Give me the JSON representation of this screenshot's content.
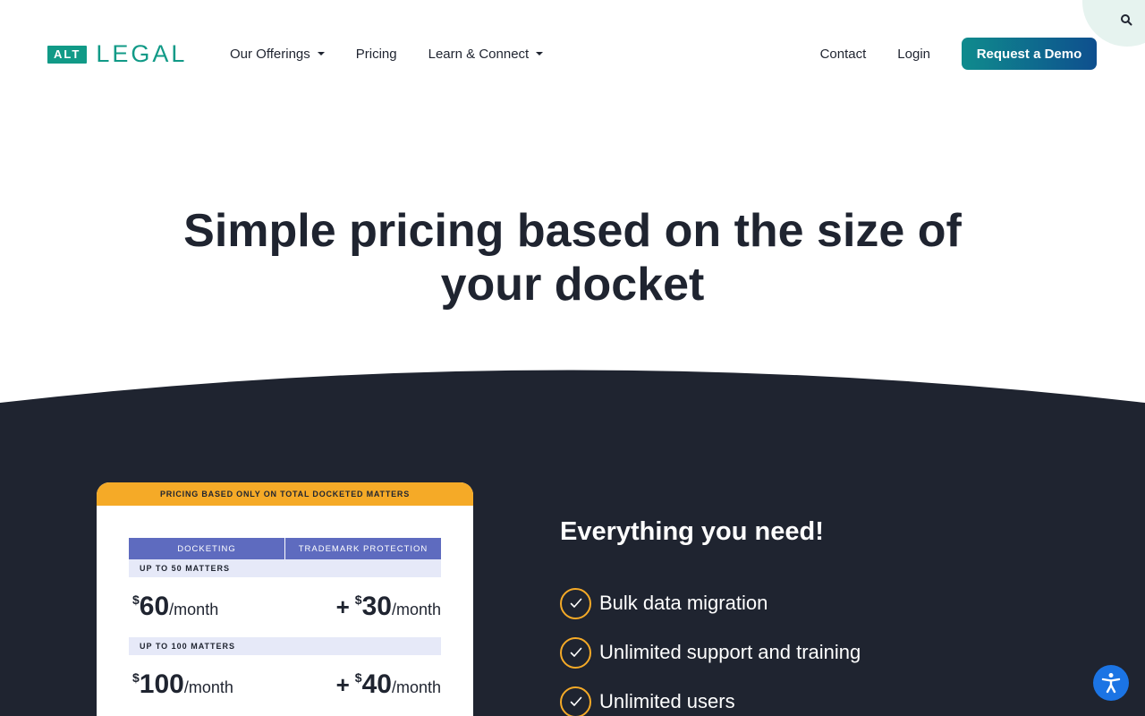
{
  "header": {
    "logo": {
      "badge": "ALT",
      "wordmark": "LEGAL"
    },
    "nav": [
      {
        "label": "Our Offerings",
        "has_dropdown": true
      },
      {
        "label": "Pricing",
        "has_dropdown": false
      },
      {
        "label": "Learn & Connect",
        "has_dropdown": true
      }
    ],
    "contact_label": "Contact",
    "login_label": "Login",
    "demo_button_label": "Request a Demo",
    "search_icon": "search-icon"
  },
  "hero": {
    "title_line1": "Simple pricing based on the size of",
    "title_line2": "your docket"
  },
  "pricing_card": {
    "banner": "PRICING BASED ONLY ON TOTAL DOCKETED MATTERS",
    "columns": [
      "DOCKETING",
      "TRADEMARK PROTECTION"
    ],
    "tiers": [
      {
        "label": "UP TO 50 MATTERS",
        "docketing": {
          "currency": "$",
          "amount": "60",
          "period": "/month"
        },
        "trademark": {
          "prefix": "+",
          "currency": "$",
          "amount": "30",
          "period": "/month"
        }
      },
      {
        "label": "UP TO 100 MATTERS",
        "docketing": {
          "currency": "$",
          "amount": "100",
          "period": "/month"
        },
        "trademark": {
          "prefix": "+",
          "currency": "$",
          "amount": "40",
          "period": "/month"
        }
      }
    ]
  },
  "features": {
    "title": "Everything you need!",
    "items": [
      "Bulk data migration",
      "Unlimited support and training",
      "Unlimited users"
    ]
  },
  "colors": {
    "brand_teal": "#119a87",
    "dark_bg": "#1f2430",
    "accent_orange": "#f5aa27",
    "table_header": "#5e6bbf",
    "tier_bg": "#e6e9f8",
    "a11y_blue": "#1b74e4"
  },
  "accessibility_icon": "accessibility-icon"
}
